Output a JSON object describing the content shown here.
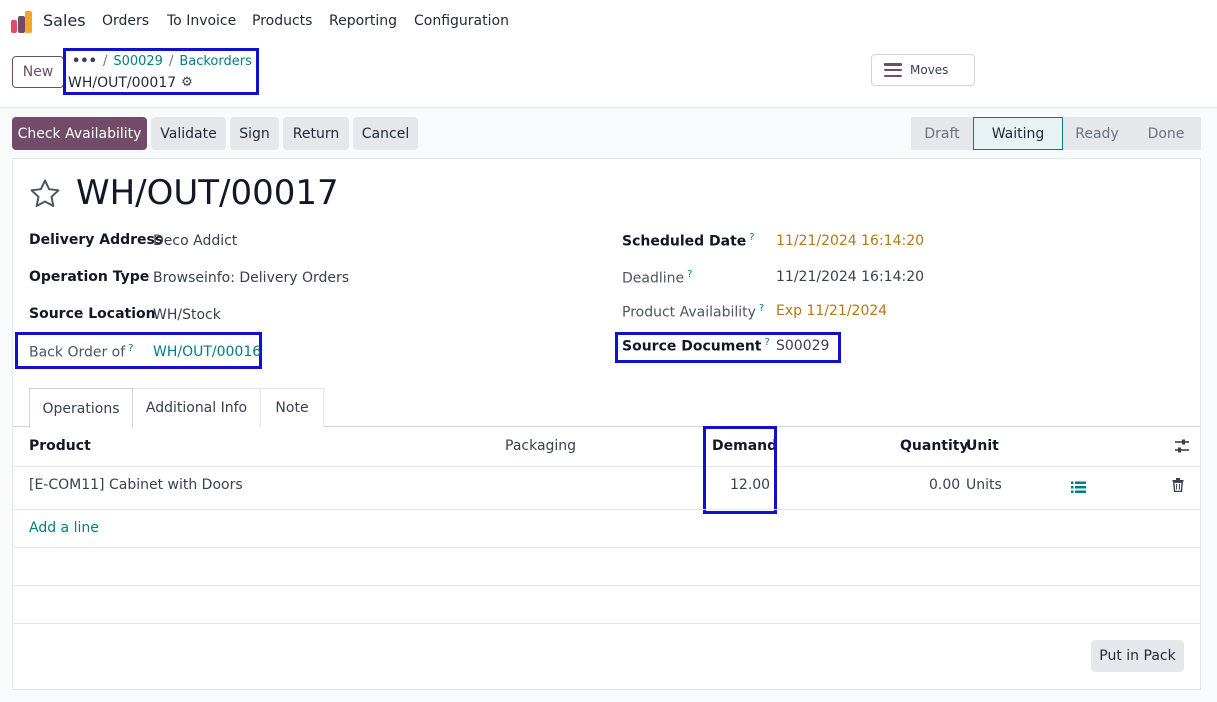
{
  "nav": {
    "app_name": "Sales",
    "menu": [
      "Orders",
      "To Invoice",
      "Products",
      "Reporting",
      "Configuration"
    ]
  },
  "control": {
    "new_label": "New",
    "breadcrumb_ellipsis": "•••",
    "breadcrumb": [
      "S00029",
      "Backorders"
    ],
    "current_record": "WH/OUT/00017",
    "moves_label": "Moves"
  },
  "actions": {
    "check_availability": "Check Availability",
    "validate": "Validate",
    "sign": "Sign",
    "return": "Return",
    "cancel": "Cancel"
  },
  "status": {
    "stages": [
      "Draft",
      "Waiting",
      "Ready",
      "Done"
    ],
    "active": "Waiting"
  },
  "record": {
    "title": "WH/OUT/00017",
    "help_mark": "?",
    "delivery_address_label": "Delivery Address",
    "delivery_address": "Deco Addict",
    "operation_type_label": "Operation Type",
    "operation_type": "Browseinfo: Delivery Orders",
    "source_location_label": "Source Location",
    "source_location": "WH/Stock",
    "back_order_of_label": "Back Order of",
    "back_order_of": "WH/OUT/00016",
    "scheduled_date_label": "Scheduled Date",
    "scheduled_date": "11/21/2024 16:14:20",
    "deadline_label": "Deadline",
    "deadline": "11/21/2024 16:14:20",
    "product_availability_label": "Product Availability",
    "product_availability": "Exp 11/21/2024",
    "source_document_label": "Source Document",
    "source_document": "S00029"
  },
  "tabs": [
    "Operations",
    "Additional Info",
    "Note"
  ],
  "table": {
    "headers": {
      "product": "Product",
      "packaging": "Packaging",
      "demand": "Demand",
      "quantity": "Quantity",
      "unit": "Unit"
    },
    "rows": [
      {
        "product": "[E-COM11] Cabinet with Doors",
        "packaging": "",
        "demand": "12.00",
        "quantity": "0.00",
        "unit": "Units"
      }
    ],
    "add_line": "Add a line"
  },
  "footer": {
    "put_in_pack": "Put in Pack"
  },
  "colors": {
    "brand": "#714b67",
    "link": "#017e84",
    "warning": "#b07a12",
    "highlight": "#1010d0"
  }
}
